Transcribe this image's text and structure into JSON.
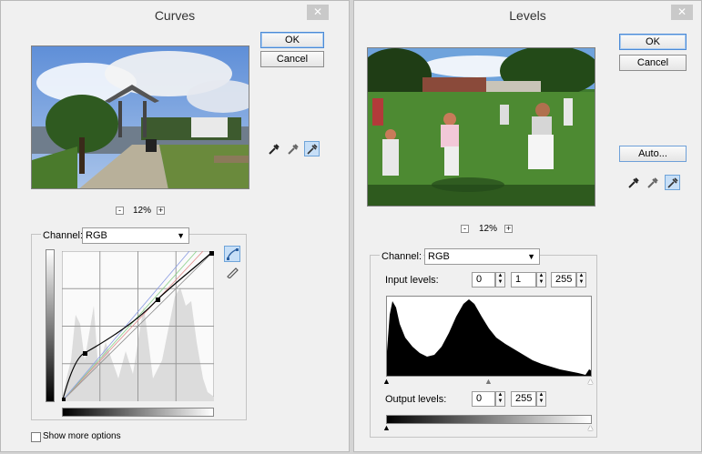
{
  "curves": {
    "title": "Curves",
    "close_glyph": "✕",
    "ok_label": "OK",
    "cancel_label": "Cancel",
    "zoom": {
      "minus": "-",
      "value": "12%",
      "plus": "+"
    },
    "channel_label": "Channel:",
    "channel_value": "RGB",
    "show_more_label": "Show more options",
    "icons": [
      "black-point-eyedropper-icon",
      "gray-point-eyedropper-icon",
      "white-point-eyedropper-icon",
      "curve-tool-icon",
      "pencil-tool-icon"
    ]
  },
  "levels": {
    "title": "Levels",
    "close_glyph": "✕",
    "ok_label": "OK",
    "cancel_label": "Cancel",
    "auto_label": "Auto...",
    "zoom": {
      "minus": "-",
      "value": "12%",
      "plus": "+"
    },
    "channel_label": "Channel:",
    "channel_value": "RGB",
    "input_levels_label": "Input levels:",
    "input_black": "0",
    "input_gamma": "1",
    "input_white": "255",
    "output_levels_label": "Output levels:",
    "output_black": "0",
    "output_white": "255",
    "icons": [
      "black-point-eyedropper-icon",
      "gray-point-eyedropper-icon",
      "white-point-eyedropper-icon"
    ]
  },
  "colors": {
    "accent": "#4b8ad6",
    "dialog_bg": "#f0f0f0",
    "active_tool": "#c7dff7"
  }
}
